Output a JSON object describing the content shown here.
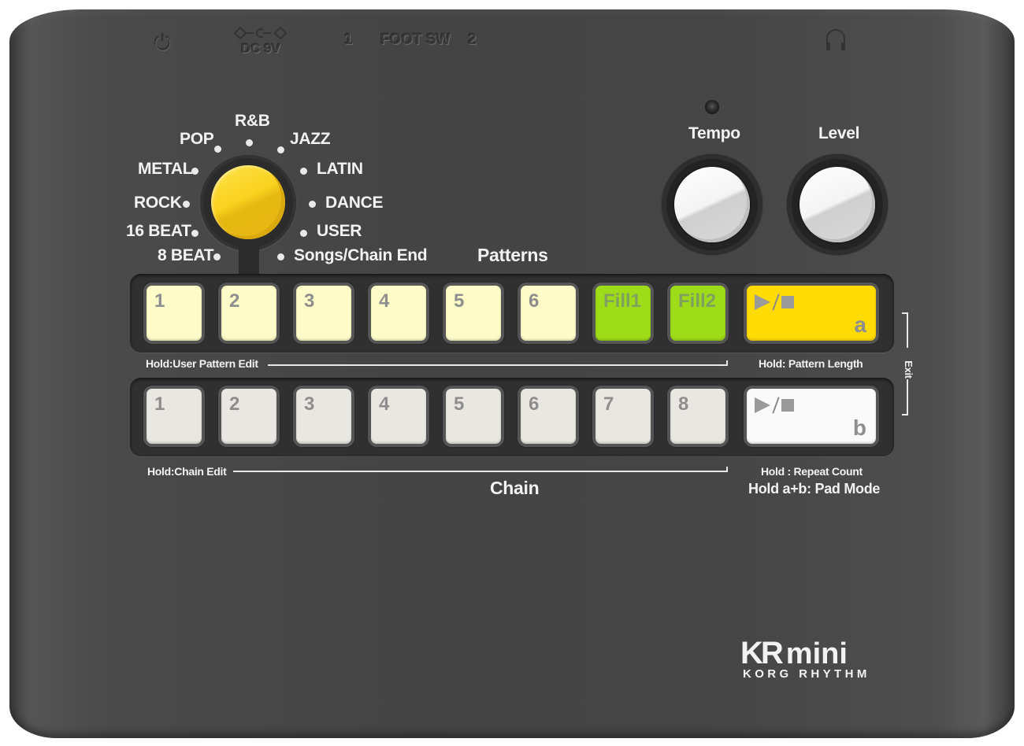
{
  "device": {
    "brand_logo": "KR mini",
    "brand_logo_kr": "KR",
    "brand_logo_mini": "mini",
    "brand_sub": "KORG RHYTHM"
  },
  "rear_panel": {
    "power_icon": "power-icon",
    "dc_label": "DC 9V",
    "foot_sw_1": "1",
    "foot_sw_label": "FOOT SW",
    "foot_sw_2": "2",
    "headphone_icon": "headphones-icon"
  },
  "genre_selector": {
    "selected": "8 BEAT",
    "options": [
      "8 BEAT",
      "16 BEAT",
      "ROCK",
      "METAL",
      "POP",
      "R&B",
      "JAZZ",
      "LATIN",
      "DANCE",
      "USER",
      "Songs/Chain End"
    ]
  },
  "knobs": {
    "tempo_label": "Tempo",
    "level_label": "Level"
  },
  "patterns": {
    "section_label": "Patterns",
    "pads": [
      "1",
      "2",
      "3",
      "4",
      "5",
      "6",
      "Fill1",
      "Fill2"
    ],
    "play_stop_letter": "a",
    "hold_left": "Hold:User Pattern Edit",
    "hold_right": "Hold: Pattern Length"
  },
  "chain": {
    "section_label": "Chain",
    "pads": [
      "1",
      "2",
      "3",
      "4",
      "5",
      "6",
      "7",
      "8"
    ],
    "play_stop_letter": "b",
    "hold_left": "Hold:Chain Edit",
    "hold_right": "Hold : Repeat Count",
    "hold_ab": "Hold a+b: Pad Mode"
  },
  "exit_label": "Exit",
  "colors": {
    "body": "#454545",
    "pattern_pad": "#fdfcc8",
    "fill_pad": "#9edb18",
    "play_a_pad": "#fedb05",
    "chain_pad": "#e9e7e1",
    "play_b_pad": "#fafafa",
    "selector_knob": "#f8d21e"
  }
}
